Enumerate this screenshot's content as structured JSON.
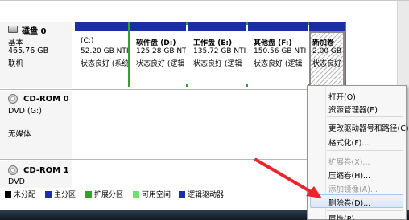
{
  "disk0": {
    "name": "磁盘 0",
    "type": "基本",
    "size": "465.76 GB",
    "status": "联机",
    "partitions": [
      {
        "title": "(C:)",
        "size": "52.20 GB NTI",
        "status": "状态良好 (系统"
      },
      {
        "title": "软件盘  (D:)",
        "size": "125.28 GB NTI",
        "status": "状态良好 (逻辑"
      },
      {
        "title": "工作盘  (E:)",
        "size": "135.72 GB NTI",
        "status": "状态良好 (逻辑"
      },
      {
        "title": "其他盘  (F:)",
        "size": "150.56 GB NTI",
        "status": "状态良好 (逻辑"
      },
      {
        "title": "新加卷",
        "size": "2.00 GB",
        "status": "状态良好"
      }
    ]
  },
  "cdrom0": {
    "name": "CD-ROM 0",
    "drive": "DVD (G:)",
    "media": "无媒体"
  },
  "cdrom1": {
    "name": "CD-ROM 1",
    "drive": "DVD"
  },
  "legend": [
    {
      "label": "未分配",
      "color": "#000000"
    },
    {
      "label": "主分区",
      "color": "#1a2ea8"
    },
    {
      "label": "扩展分区",
      "color": "#2ea12e"
    },
    {
      "label": "可用空间",
      "color": "#6fe06f"
    },
    {
      "label": "逻辑驱动器",
      "color": "#1a2ea8"
    }
  ],
  "context_menu": {
    "items": [
      {
        "label": "打开(O)",
        "enabled": true
      },
      {
        "label": "资源管理器(E)",
        "enabled": true
      },
      {
        "label": "更改驱动器号和路径(C)...",
        "enabled": true
      },
      {
        "label": "格式化(F)...",
        "enabled": true
      },
      {
        "label": "扩展卷(X)...",
        "enabled": false
      },
      {
        "label": "压缩卷(H)...",
        "enabled": true
      },
      {
        "label": "添加镜像(A)...",
        "enabled": false
      },
      {
        "label": "删除卷(D)...",
        "enabled": true
      },
      {
        "label": "属性(P)",
        "enabled": true
      }
    ],
    "highlighted": "删除卷(D)..."
  },
  "colors": {
    "primary_partition": "#1a2ea8",
    "extended_partition": "#2ea12e",
    "annotation_arrow": "#e8242c"
  }
}
